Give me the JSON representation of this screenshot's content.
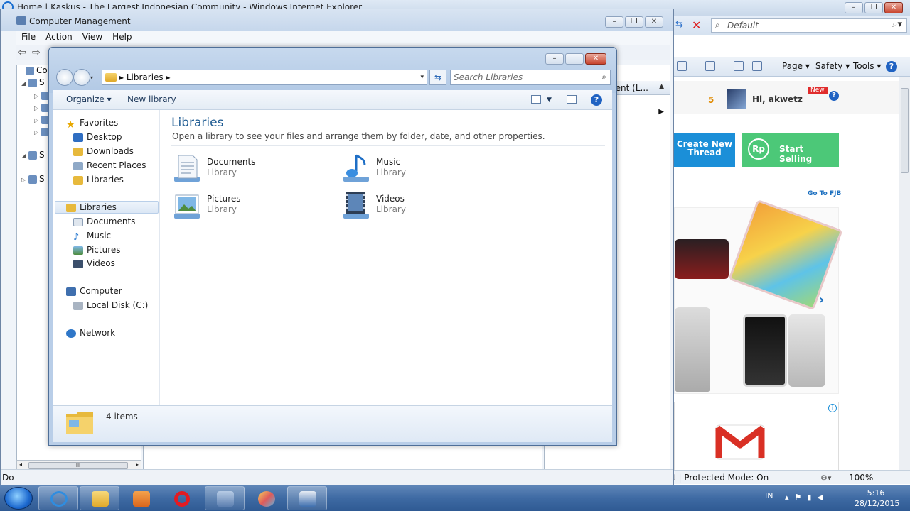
{
  "ie": {
    "title": "Home | Kaskus - The Largest Indonesian Community - Windows Internet Explorer",
    "search_placeholder": "Default",
    "commands": {
      "page": "Page ▾",
      "safety": "Safety ▾",
      "tools": "Tools ▾",
      "help": "?"
    },
    "kaskus": {
      "notif_count": "5",
      "greeting": "Hi, akwetz",
      "new_badge": "New",
      "create_thread": "Create New Thread",
      "start_selling": "Start Selling",
      "rp": "Rp",
      "go_fjb": "Go To FJB",
      "info": "i"
    },
    "status": {
      "protected_mode": "t | Protected Mode: On",
      "zoom": "100%"
    }
  },
  "cm": {
    "title": "Computer Management",
    "menu": [
      "File",
      "Action",
      "View",
      "Help"
    ],
    "tree": [
      {
        "label": "Compu",
        "twisty": ""
      },
      {
        "label": "S",
        "twisty": "◢"
      },
      {
        "label": "",
        "twisty": "▷"
      },
      {
        "label": "",
        "twisty": "▷"
      },
      {
        "label": "",
        "twisty": "▷"
      },
      {
        "label": "",
        "twisty": "▷"
      },
      {
        "label": "S",
        "twisty": "◢"
      },
      {
        "label": "S",
        "twisty": "▷"
      }
    ],
    "hscroll_grip": "III",
    "right_header": "ment (L...",
    "status": "Do"
  },
  "explorer": {
    "breadcrumb": "▸  Libraries  ▸",
    "search_placeholder": "Search Libraries",
    "organize": "Organize ▾",
    "new_library": "New library",
    "help": "?",
    "nav": {
      "favorites": "Favorites",
      "desktop": "Desktop",
      "downloads": "Downloads",
      "recent": "Recent Places",
      "libraries_fav": "Libraries",
      "libraries": "Libraries",
      "documents": "Documents",
      "music": "Music",
      "pictures": "Pictures",
      "videos": "Videos",
      "computer": "Computer",
      "local_disk": "Local Disk (C:)",
      "network": "Network"
    },
    "heading": "Libraries",
    "subheading": "Open a library to see your files and arrange them by folder, date, and other properties.",
    "libraries": [
      {
        "name": "Documents",
        "type": "Library"
      },
      {
        "name": "Music",
        "type": "Library"
      },
      {
        "name": "Pictures",
        "type": "Library"
      },
      {
        "name": "Videos",
        "type": "Library"
      }
    ],
    "item_count": "4 items"
  },
  "taskbar": {
    "language": "IN",
    "time": "5:16",
    "date": "28/12/2015"
  }
}
